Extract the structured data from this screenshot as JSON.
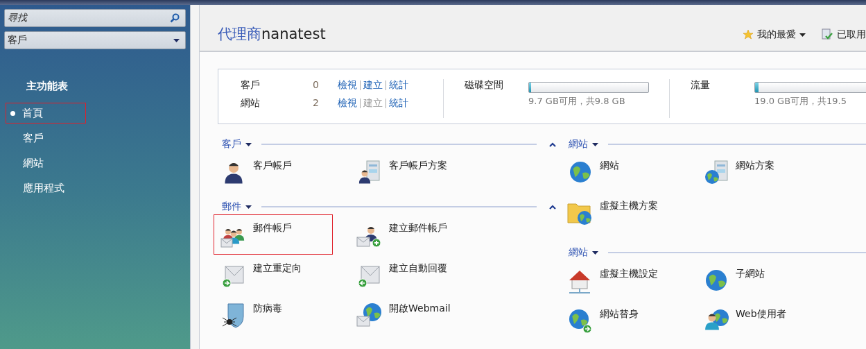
{
  "sidebar": {
    "search": {
      "placeholder": "尋找"
    },
    "scope_select": {
      "value": "客戶"
    },
    "menu_title": "主功能表",
    "menu_items": [
      {
        "label": "首頁",
        "selected": true,
        "highlighted": true
      },
      {
        "label": "客戶",
        "selected": false,
        "highlighted": false
      },
      {
        "label": "網站",
        "selected": false,
        "highlighted": false
      },
      {
        "label": "應用程式",
        "selected": false,
        "highlighted": false
      }
    ]
  },
  "header": {
    "title": {
      "label": "代理商",
      "name": "nanatest"
    },
    "favorites": "我的最愛",
    "disabled_link": "已取用"
  },
  "summary": {
    "counts": [
      {
        "label": "客戶",
        "count": "0",
        "links": [
          {
            "label": "檢視",
            "disabled": false
          },
          {
            "label": "建立",
            "disabled": false
          },
          {
            "label": "統計",
            "disabled": false
          }
        ]
      },
      {
        "label": "網站",
        "count": "2",
        "links": [
          {
            "label": "檢視",
            "disabled": false
          },
          {
            "label": "建立",
            "disabled": true
          },
          {
            "label": "統計",
            "disabled": false
          }
        ]
      }
    ],
    "meters": [
      {
        "label": "磁碟空間",
        "level": 0.01,
        "reading": "9.7 GB可用，共9.8 GB"
      },
      {
        "label": "流量",
        "level": 0.03,
        "reading": "19.0 GB可用，共19.5"
      }
    ]
  },
  "columns": [
    {
      "sections": [
        {
          "title": "客戶",
          "collapse_button": true,
          "items": [
            {
              "label": "客戶帳戶",
              "highlighted": false
            },
            {
              "label": "客戶帳戶方案",
              "highlighted": false
            }
          ]
        },
        {
          "title": "郵件",
          "collapse_button": true,
          "items": [
            {
              "label": "郵件帳戶",
              "highlighted": true
            },
            {
              "label": "建立郵件帳戶",
              "highlighted": false
            },
            {
              "label": "建立重定向",
              "highlighted": false
            },
            {
              "label": "建立自動回覆",
              "highlighted": false
            },
            {
              "label": "防病毒",
              "highlighted": false
            },
            {
              "label": "開啟Webmail",
              "highlighted": false
            }
          ]
        }
      ]
    },
    {
      "sections": [
        {
          "title": "網站",
          "collapse_button": false,
          "items": [
            {
              "label": "網站",
              "highlighted": false
            },
            {
              "label": "網站方案",
              "highlighted": false
            },
            {
              "label": "虛擬主機方案",
              "highlighted": false
            }
          ]
        },
        {
          "title": "網站",
          "collapse_button": false,
          "items": [
            {
              "label": "虛擬主機設定",
              "highlighted": false
            },
            {
              "label": "子網站",
              "highlighted": false
            },
            {
              "label": "網站替身",
              "highlighted": false
            },
            {
              "label": "Web使用者",
              "highlighted": false
            }
          ]
        }
      ]
    }
  ]
}
